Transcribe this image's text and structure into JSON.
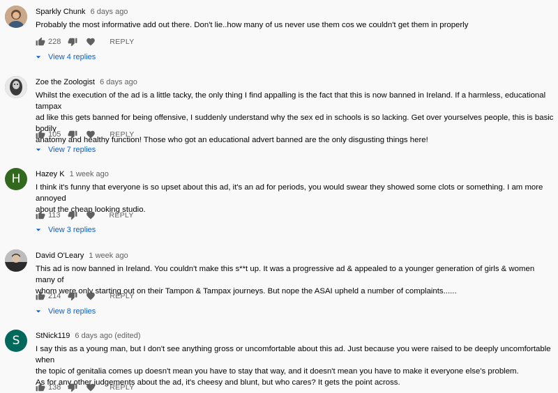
{
  "comments": [
    {
      "author": "Sparkly Chunk",
      "time": "6 days ago",
      "text": "Probably the most informative add out there. Don't lie..how many of us never use them cos we couldn't get them in properly",
      "likes": "228",
      "reply_label": "REPLY",
      "replies_label": "View 4 replies",
      "avatar": {
        "type": "photo",
        "color": "#8a6b52"
      }
    },
    {
      "author": "Zoe the Zoologist",
      "time": "6 days ago",
      "text": "Whilst the execution of the ad is a little tacky, the only thing I find appalling is the fact that this is now banned in Ireland. If a harmless, educational tampax\nad like this gets banned for being offensive, I suddenly understand why the sex ed in schools is so lacking. Get over yourselves people, this is basic bodily\nanatomy and healthy function! Those who got an educational advert banned are the only disgusting things here!",
      "likes": "105",
      "reply_label": "REPLY",
      "replies_label": "View 7 replies",
      "avatar": {
        "type": "photo",
        "color": "#5a5a5a"
      }
    },
    {
      "author": "Hazey K",
      "time": "1 week ago",
      "text": "I think it's funny that everyone is so upset about this ad, it's an ad for periods, you would swear they showed some clots or something. I am more annoyed\nabout the cheap looking studio.",
      "likes": "113",
      "reply_label": "REPLY",
      "replies_label": "View 3 replies",
      "avatar": {
        "type": "letter",
        "letter": "H",
        "color": "#33691e"
      }
    },
    {
      "author": "David O'Leary",
      "time": "1 week ago",
      "text": "This ad is now banned in Ireland. You couldn't make this s**t up. It was a progressive ad & appealed to a younger generation of girls & women many of\nwhom were only starting out on their Tampon & Tampax journeys. But nope the ASAI upheld a number of complaints......",
      "likes": "214",
      "reply_label": "REPLY",
      "replies_label": "View 8 replies",
      "avatar": {
        "type": "photo",
        "color": "#6d6d6d"
      }
    },
    {
      "author": "StNick119",
      "time": "6 days ago (edited)",
      "text": "I say this as a young man, but I don't see anything gross or uncomfortable about this ad. Just because you were raised to be deeply uncomfortable when\nthe topic of genitalia comes up doesn't mean you have to stay that way, and it doesn't mean you have to make it everyone else's problem.\nAs for any other judgements about the ad, it's cheesy and blunt, but who cares? It gets the point across.",
      "likes": "138",
      "reply_label": "REPLY",
      "replies_label": "",
      "avatar": {
        "type": "letter",
        "letter": "S",
        "color": "#00695c"
      }
    }
  ]
}
